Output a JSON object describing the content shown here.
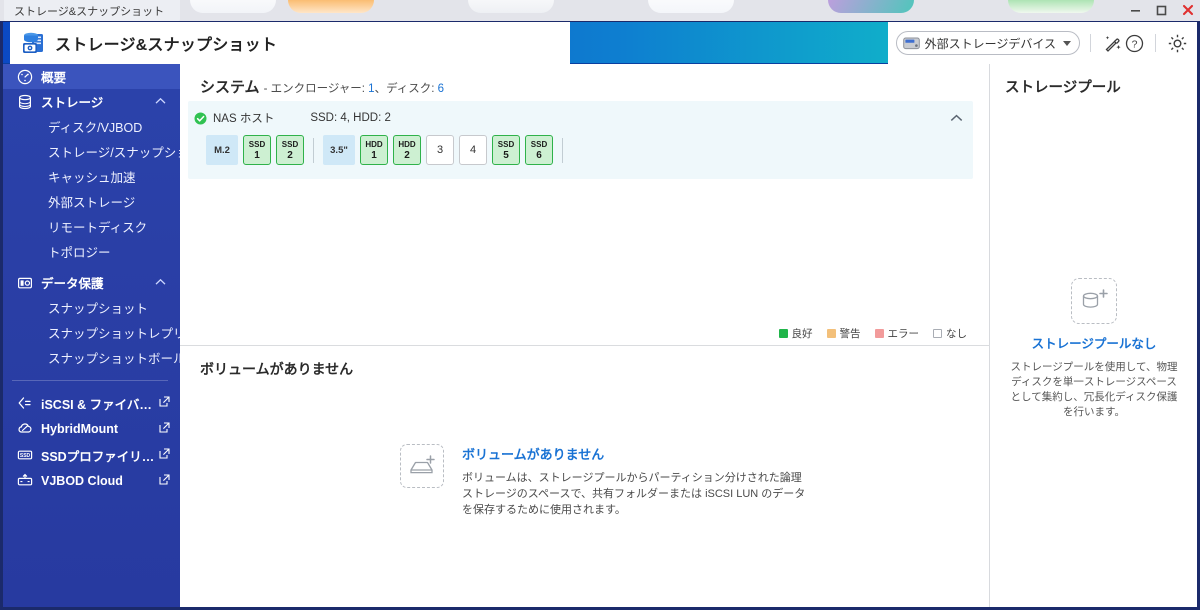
{
  "window": {
    "tab_title": "ストレージ&スナップショット",
    "controls": {
      "minimize": "minimize-button",
      "maximize": "maximize-button",
      "close": "close-button"
    },
    "ghost_tabs": [
      {
        "color_start": "#ffffff",
        "color_end": "#f2f4f8"
      },
      {
        "color_start": "#f5941d",
        "color_end": "#ffe6c8"
      },
      {
        "color_start": "#ffffff",
        "color_end": "#eef0f4"
      },
      {
        "color_start": "#ffffff",
        "color_end": "#f4f6fa"
      },
      {
        "color_start": "#c39cdf",
        "color_end": "#4fc6bb"
      },
      {
        "color_start": "#6bcf7a",
        "color_end": "#f0f8ee"
      }
    ]
  },
  "header": {
    "app_title": "ストレージ&スナップショット",
    "logo_icon": "storage-snapshot-logo-icon",
    "dropdown": {
      "icon": "external-disk-icon",
      "label": "外部ストレージデバイス",
      "caret": "chevron-down-icon"
    },
    "icons": [
      {
        "name": "wand-tool-icon"
      },
      {
        "name": "help-circle-icon"
      },
      {
        "name": "settings-gear-icon"
      }
    ]
  },
  "sidebar": {
    "groups": [
      {
        "label": "概要",
        "icon": "dashboard-gauge-icon",
        "type": "item",
        "active": true
      },
      {
        "label": "ストレージ",
        "icon": "storage-stack-icon",
        "type": "group",
        "chevron": "chevron-up-icon",
        "children": [
          "ディスク/VJBOD",
          "ストレージ/スナップショ...",
          "キャッシュ加速",
          "外部ストレージ",
          "リモートディスク",
          "トポロジー"
        ]
      },
      {
        "label": "データ保護",
        "icon": "data-protection-icon",
        "type": "group",
        "chevron": "chevron-up-icon",
        "children": [
          "スナップショット",
          "スナップショットレプリカ",
          "スナップショットボールト"
        ]
      }
    ],
    "external_links": [
      {
        "label": "iSCSI & ファイバー...",
        "icon": "iscsi-icon",
        "link_icon": "external-link-icon"
      },
      {
        "label": "HybridMount",
        "icon": "hybridmount-cloud-icon",
        "link_icon": "external-link-icon"
      },
      {
        "label": "SSDプロファイリン...",
        "icon": "ssd-profiling-icon",
        "link_icon": "external-link-icon"
      },
      {
        "label": "VJBOD Cloud",
        "icon": "vjbod-cloud-icon",
        "link_icon": "external-link-icon"
      }
    ]
  },
  "system": {
    "title": "システム",
    "subtitle_prefix": " - エンクロージャー: ",
    "enclosure_count": "1",
    "subtitle_mid": "、ディスク: ",
    "disk_count": "6",
    "enclosure": {
      "status_icon": "status-ok-icon",
      "name": "NAS ホスト",
      "counts": "SSD: 4, HDD: 2",
      "collapse_icon": "chevron-up-icon"
    },
    "slot_groups": [
      {
        "type_label": "M.2",
        "slots": [
          {
            "kind": "SSD",
            "num": "1",
            "state": "good"
          },
          {
            "kind": "SSD",
            "num": "2",
            "state": "good"
          }
        ]
      },
      {
        "type_label": "3.5\"",
        "slots": [
          {
            "kind": "HDD",
            "num": "1",
            "state": "good"
          },
          {
            "kind": "HDD",
            "num": "2",
            "state": "good"
          },
          {
            "kind": "",
            "num": "3",
            "state": "empty"
          },
          {
            "kind": "",
            "num": "4",
            "state": "empty"
          },
          {
            "kind": "SSD",
            "num": "5",
            "state": "good"
          },
          {
            "kind": "SSD",
            "num": "6",
            "state": "good"
          }
        ]
      }
    ],
    "legend": [
      {
        "label": "良好",
        "color": "#21b54a"
      },
      {
        "label": "警告",
        "color": "#f3c07a"
      },
      {
        "label": "エラー",
        "color": "#f29b9b"
      },
      {
        "label": "なし",
        "color": "#ffffff"
      }
    ]
  },
  "volumes": {
    "section_title": "ボリュームがありません",
    "empty_icon": "add-volume-icon",
    "empty_title": "ボリュームがありません",
    "empty_desc": "ボリュームは、ストレージプールからパーティション分けされた論理ストレージのスペースで、共有フォルダーまたは iSCSI LUN のデータを保存するために使用されます。"
  },
  "pool_panel": {
    "title": "ストレージプール",
    "empty_icon": "add-storage-pool-icon",
    "empty_title": "ストレージプールなし",
    "empty_desc": "ストレージプールを使用して、物理ディスクを単一ストレージスペースとして集約し、冗長化ディスク保護を行います。"
  },
  "colors": {
    "accent_blue": "#1a73d4",
    "sidebar_blue": "#2a3fa6",
    "good_green": "#2fb24a",
    "frame_navy": "#1b2a6b"
  }
}
